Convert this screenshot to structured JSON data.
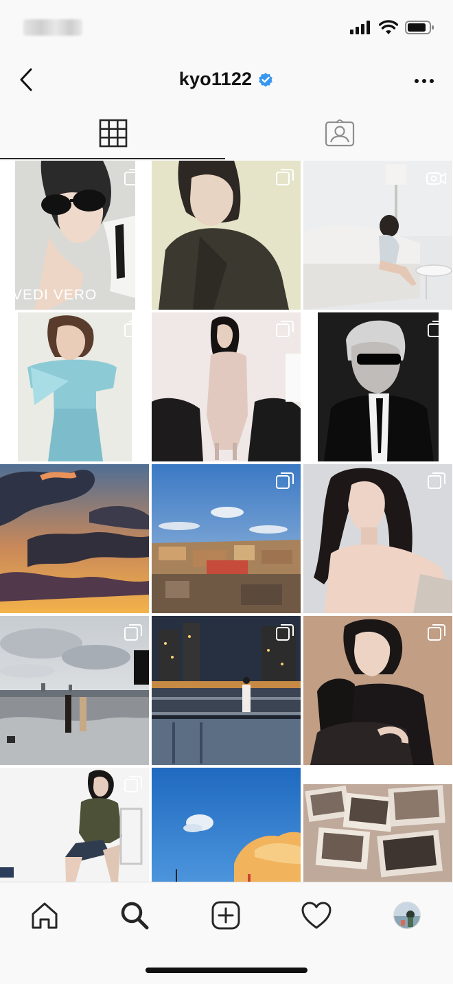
{
  "header": {
    "username": "kyo1122",
    "verified": true
  },
  "status_bar": {
    "time_blurred": true,
    "icons": [
      "signal-icon",
      "wifi-icon",
      "battery-icon"
    ]
  },
  "tabs": [
    {
      "icon": "grid-icon",
      "active": true
    },
    {
      "icon": "tagged-icon",
      "active": false
    }
  ],
  "posts": [
    {
      "badge": "multi",
      "caption": "VEDI VERO"
    },
    {
      "badge": "multi",
      "caption": ""
    },
    {
      "badge": "video",
      "caption": ""
    },
    {
      "badge": "multi",
      "caption": ""
    },
    {
      "badge": "multi",
      "caption": ""
    },
    {
      "badge": "multi",
      "caption": ""
    },
    {
      "badge": "none",
      "caption": ""
    },
    {
      "badge": "multi",
      "caption": ""
    },
    {
      "badge": "multi",
      "caption": ""
    },
    {
      "badge": "multi",
      "caption": ""
    },
    {
      "badge": "multi",
      "caption": ""
    },
    {
      "badge": "multi",
      "caption": ""
    },
    {
      "badge": "multi",
      "caption": ""
    },
    {
      "badge": "none",
      "caption": ""
    },
    {
      "badge": "none",
      "caption": ""
    }
  ],
  "bottom_nav": [
    "home-icon",
    "search-icon",
    "new-post-icon",
    "activity-heart-icon",
    "profile-avatar"
  ],
  "colors": {
    "verified_blue": "#3897f0",
    "text": "#262626",
    "background": "#f9f9f9"
  }
}
